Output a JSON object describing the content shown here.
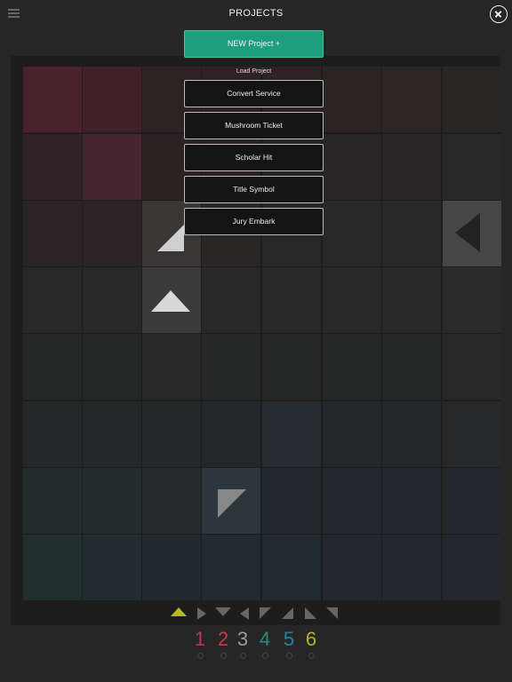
{
  "header": {
    "title": "PROJECTS"
  },
  "modal": {
    "new_project_label": "NEW Project +",
    "load_label": "Load Project",
    "projects": [
      "Convert Service",
      "Mushroom Ticket",
      "Scholar Hit",
      "Title Symbol",
      "Jury Embark"
    ]
  },
  "pad_numbers": [
    "1",
    "2",
    "3",
    "4",
    "5",
    "6"
  ],
  "colors": {
    "accent": "#1f9e7e",
    "background": "#262626",
    "num1": "#b83a55",
    "num2": "#c43a4c",
    "num3": "#9a9a9a",
    "num4": "#2d8c7f",
    "num5": "#2f7f9c",
    "num6": "#b0b02a"
  },
  "icons": [
    "menu-icon",
    "close-icon"
  ]
}
